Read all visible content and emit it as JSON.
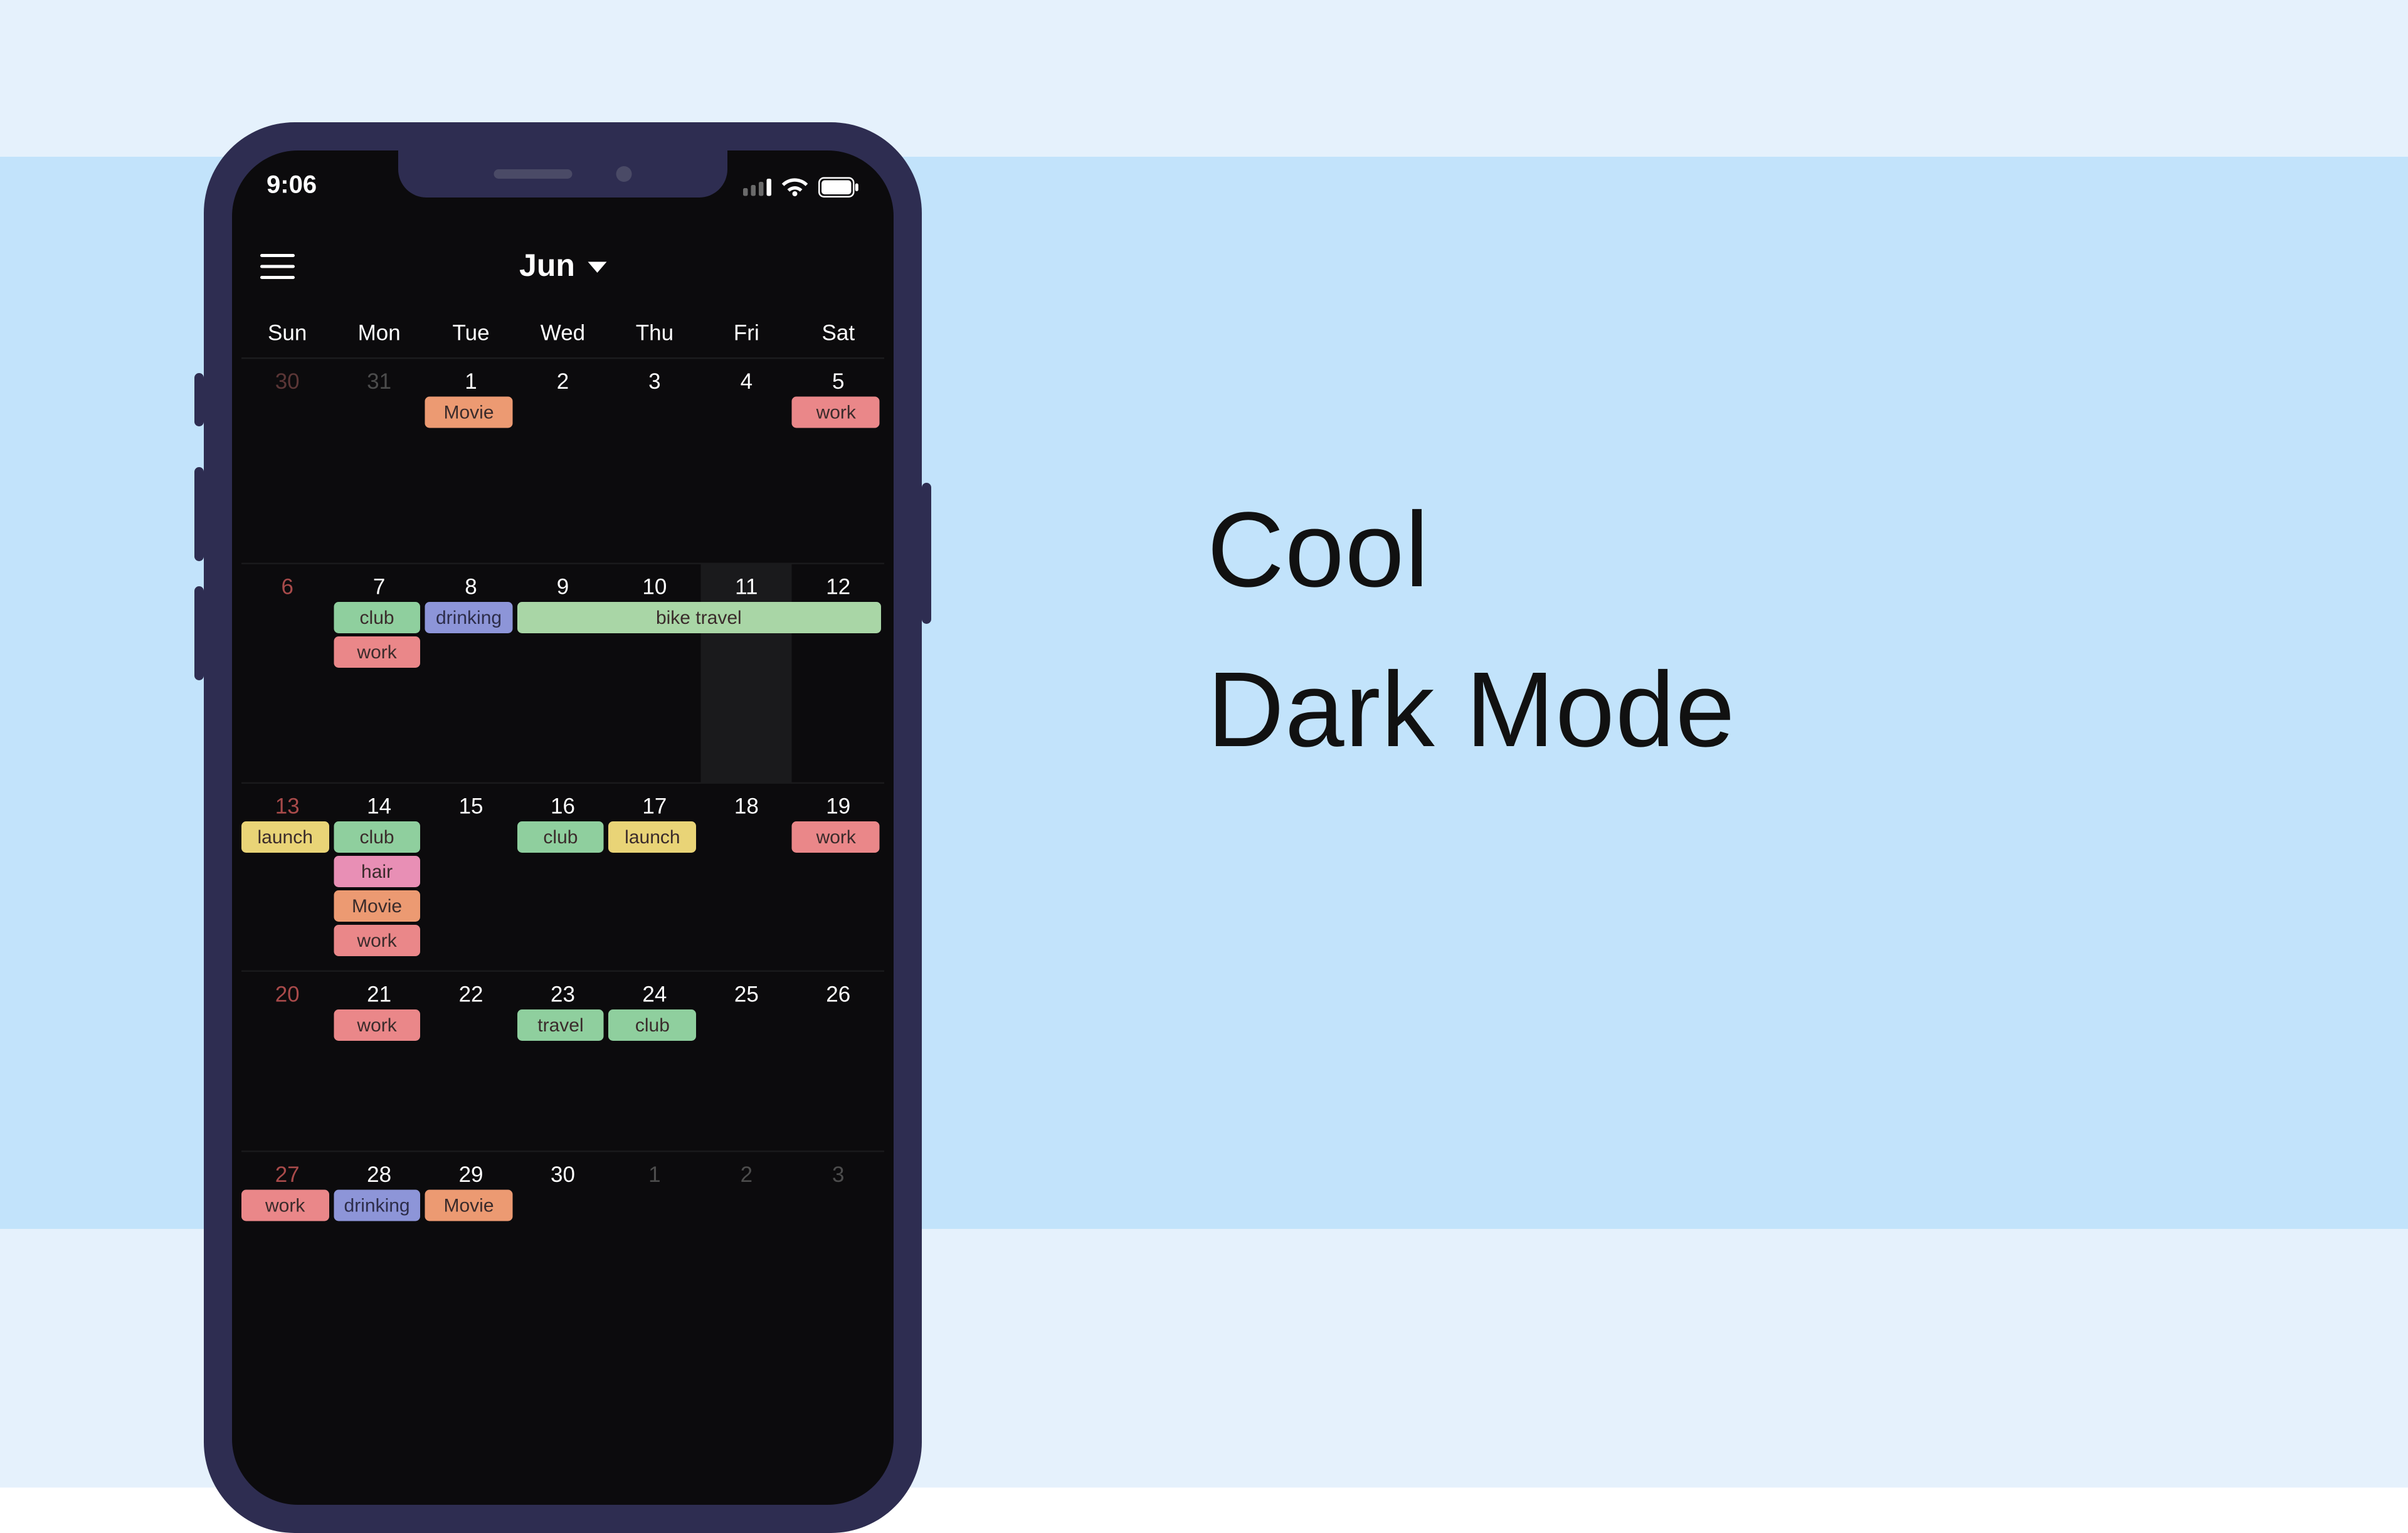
{
  "headline": {
    "line1": "Cool",
    "line2": "Dark Mode"
  },
  "statusbar": {
    "time": "9:06"
  },
  "header": {
    "month_label": "Jun"
  },
  "weekdays": [
    "Sun",
    "Mon",
    "Tue",
    "Wed",
    "Thu",
    "Fri",
    "Sat"
  ],
  "weeks": [
    {
      "days": [
        {
          "num": "30",
          "sun": true,
          "other": true
        },
        {
          "num": "31",
          "other": true
        },
        {
          "num": "1"
        },
        {
          "num": "2"
        },
        {
          "num": "3"
        },
        {
          "num": "4"
        },
        {
          "num": "5"
        }
      ],
      "events": [
        {
          "label": "Movie",
          "col": 3,
          "span": 1,
          "colorKey": "movie",
          "row": 0
        },
        {
          "label": "work",
          "col": 7,
          "span": 1,
          "colorKey": "work",
          "row": 0
        }
      ]
    },
    {
      "days": [
        {
          "num": "6",
          "sun": true
        },
        {
          "num": "7"
        },
        {
          "num": "8"
        },
        {
          "num": "9"
        },
        {
          "num": "10"
        },
        {
          "num": "11",
          "today": true
        },
        {
          "num": "12"
        }
      ],
      "events": [
        {
          "label": "club",
          "col": 2,
          "span": 1,
          "colorKey": "club",
          "row": 0
        },
        {
          "label": "drinking",
          "col": 3,
          "span": 1,
          "colorKey": "drinking",
          "row": 0
        },
        {
          "label": "bike travel",
          "col": 4,
          "span": 4,
          "colorKey": "bike",
          "row": 0
        },
        {
          "label": "work",
          "col": 2,
          "span": 1,
          "colorKey": "work",
          "row": 1
        }
      ]
    },
    {
      "days": [
        {
          "num": "13",
          "sun": true
        },
        {
          "num": "14"
        },
        {
          "num": "15"
        },
        {
          "num": "16"
        },
        {
          "num": "17"
        },
        {
          "num": "18"
        },
        {
          "num": "19"
        }
      ],
      "events": [
        {
          "label": "launch",
          "col": 1,
          "span": 1,
          "colorKey": "launch",
          "row": 0
        },
        {
          "label": "club",
          "col": 2,
          "span": 1,
          "colorKey": "club",
          "row": 0
        },
        {
          "label": "club",
          "col": 4,
          "span": 1,
          "colorKey": "club",
          "row": 0
        },
        {
          "label": "launch",
          "col": 5,
          "span": 1,
          "colorKey": "launch",
          "row": 0
        },
        {
          "label": "work",
          "col": 7,
          "span": 1,
          "colorKey": "work",
          "row": 0
        },
        {
          "label": "hair",
          "col": 2,
          "span": 1,
          "colorKey": "hair",
          "row": 1
        },
        {
          "label": "Movie",
          "col": 2,
          "span": 1,
          "colorKey": "movie",
          "row": 2
        },
        {
          "label": "work",
          "col": 2,
          "span": 1,
          "colorKey": "work",
          "row": 3
        }
      ]
    },
    {
      "days": [
        {
          "num": "20",
          "sun": true
        },
        {
          "num": "21"
        },
        {
          "num": "22"
        },
        {
          "num": "23"
        },
        {
          "num": "24"
        },
        {
          "num": "25"
        },
        {
          "num": "26"
        }
      ],
      "events": [
        {
          "label": "work",
          "col": 2,
          "span": 1,
          "colorKey": "work",
          "row": 0
        },
        {
          "label": "travel",
          "col": 4,
          "span": 1,
          "colorKey": "travel",
          "row": 0
        },
        {
          "label": "club",
          "col": 5,
          "span": 1,
          "colorKey": "club",
          "row": 0
        }
      ]
    },
    {
      "days": [
        {
          "num": "27",
          "sun": true
        },
        {
          "num": "28"
        },
        {
          "num": "29"
        },
        {
          "num": "30"
        },
        {
          "num": "1",
          "other": true
        },
        {
          "num": "2",
          "other": true
        },
        {
          "num": "3",
          "other": true
        }
      ],
      "events": [
        {
          "label": "work",
          "col": 1,
          "span": 1,
          "colorKey": "work",
          "row": 0
        },
        {
          "label": "drinking",
          "col": 2,
          "span": 1,
          "colorKey": "drinking",
          "row": 0
        },
        {
          "label": "Movie",
          "col": 3,
          "span": 1,
          "colorKey": "movie",
          "row": 0
        }
      ]
    }
  ],
  "week_heights": [
    130,
    140,
    120,
    115,
    30
  ],
  "colors": {
    "movie": "#ec9a72",
    "work": "#ea8789",
    "club": "#8fcf9e",
    "drinking": "#8d95d8",
    "bike": "#a9d6a6",
    "launch": "#e9d477",
    "hair": "#e88fb5",
    "travel": "#8fcf9e"
  }
}
